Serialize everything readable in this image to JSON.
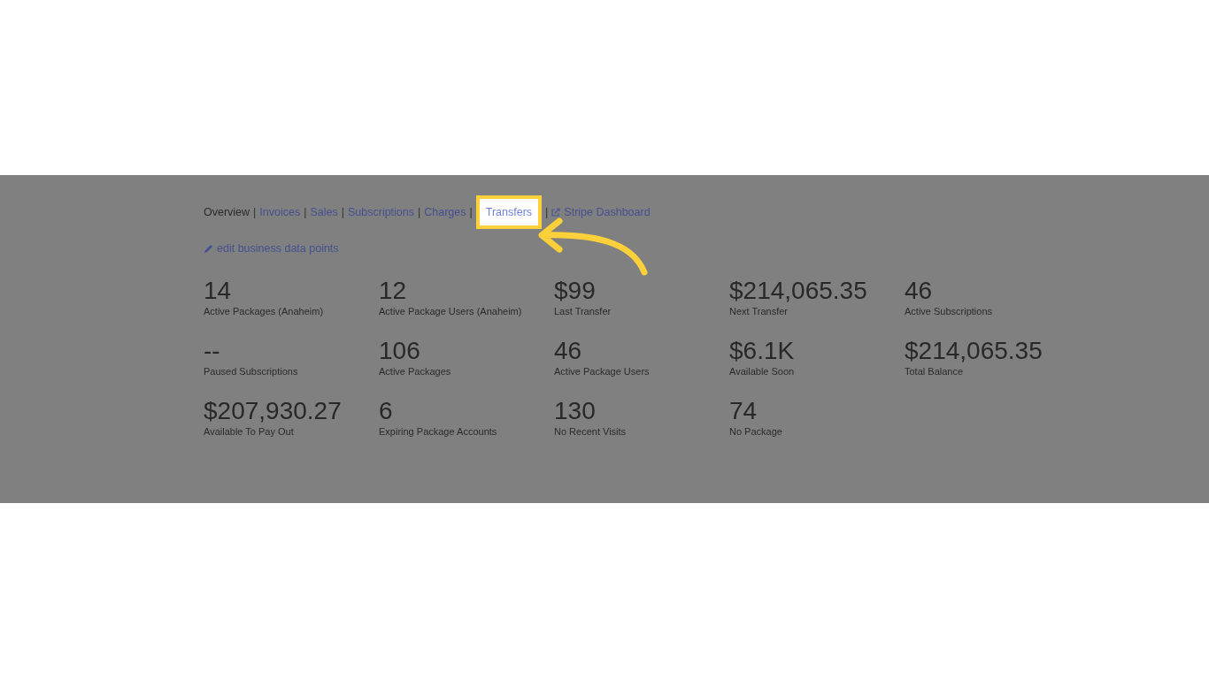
{
  "nav": [
    {
      "label": "Overview",
      "selected": true,
      "highlighted": false
    },
    {
      "label": "Invoices",
      "selected": false,
      "highlighted": false
    },
    {
      "label": "Sales",
      "selected": false,
      "highlighted": false
    },
    {
      "label": "Subscriptions",
      "selected": false,
      "highlighted": false
    },
    {
      "label": "Charges",
      "selected": false,
      "highlighted": false
    },
    {
      "label": "Transfers",
      "selected": false,
      "highlighted": true
    },
    {
      "label": "Stripe Dashboard",
      "selected": false,
      "highlighted": false,
      "external": true
    }
  ],
  "separator": "|",
  "edit_link": "edit business data points",
  "stats": [
    {
      "value": "14",
      "label": "Active Packages (Anaheim)"
    },
    {
      "value": "12",
      "label": "Active Package Users (Anaheim)"
    },
    {
      "value": "$99",
      "label": "Last Transfer"
    },
    {
      "value": "$214,065.35",
      "label": "Next Transfer"
    },
    {
      "value": "46",
      "label": "Active Subscriptions"
    },
    {
      "value": "--",
      "label": "Paused Subscriptions"
    },
    {
      "value": "106",
      "label": "Active Packages"
    },
    {
      "value": "46",
      "label": "Active Package Users"
    },
    {
      "value": "$6.1K",
      "label": "Available Soon"
    },
    {
      "value": "$214,065.35",
      "label": "Total Balance"
    },
    {
      "value": "$207,930.27",
      "label": "Available To Pay Out"
    },
    {
      "value": "6",
      "label": "Expiring Package Accounts"
    },
    {
      "value": "130",
      "label": "No Recent Visits"
    },
    {
      "value": "74",
      "label": "No Package"
    }
  ]
}
